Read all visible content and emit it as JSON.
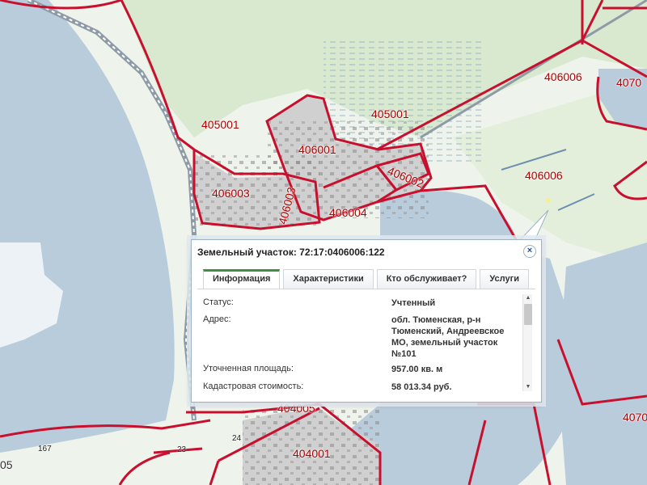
{
  "map": {
    "labels": {
      "l_405001_a": "405001",
      "l_405001_b": "405001",
      "l_406006_a": "406006",
      "l_406006_b": "406006",
      "l_4070_a": "4070",
      "l_406001": "406001",
      "l_406002": "406002",
      "l_406003": "406003",
      "l_406003_v": "406003",
      "l_406004": "406004",
      "l_404005": "404005",
      "l_404001": "404001",
      "l_4070_b": "4070",
      "l_167": "167",
      "l_23": "23",
      "l_24": "24",
      "l_05": "05"
    },
    "colors": {
      "water": "#b9ccdb",
      "land": "#eef3ec",
      "forest": "#d8e9d0",
      "boundary": "#c8102e",
      "parcel": "#cfcfcf"
    }
  },
  "popup": {
    "title": "Земельный участок: 72:17:0406006:122",
    "close_label": "×",
    "tabs": [
      {
        "label": "Информация"
      },
      {
        "label": "Характеристики"
      },
      {
        "label": "Кто обслуживает?"
      },
      {
        "label": "Услуги"
      }
    ],
    "active_tab": 0,
    "rows": [
      {
        "label": "Статус:",
        "value": "Учтенный"
      },
      {
        "label": "Адрес:",
        "value": "обл. Тюменская, р-н Тюменский, Андреевское МО, земельный участок №101"
      },
      {
        "label": "Уточненная площадь:",
        "value": "957.00 кв. м"
      },
      {
        "label": "Кадастровая стоимость:",
        "value": "58 013.34 руб."
      }
    ],
    "scroll_up": "▲",
    "scroll_down": "▼"
  }
}
